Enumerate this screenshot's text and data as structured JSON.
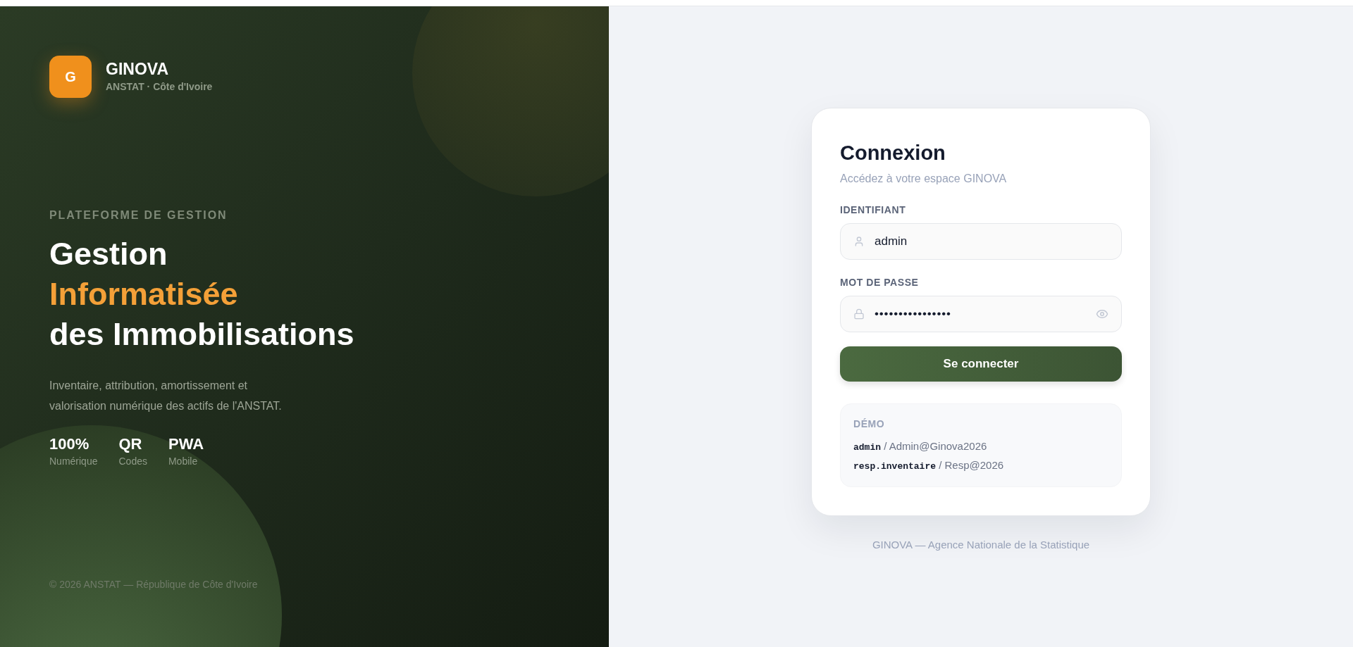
{
  "brand": {
    "logo_letter": "G",
    "name": "GINOVA",
    "subtitle": "ANSTAT · Côte d'Ivoire"
  },
  "hero": {
    "eyebrow": "PLATEFORME DE GESTION",
    "title_lines": [
      {
        "text": "Gestion",
        "accent": false
      },
      {
        "text": "Informatisée",
        "accent": true
      },
      {
        "text": "des Immobilisations",
        "accent": false
      }
    ],
    "description": "Inventaire, attribution, amortissement et valorisation numérique des actifs de l'ANSTAT.",
    "stats": [
      {
        "value": "100%",
        "label": "Numérique"
      },
      {
        "value": "QR",
        "label": "Codes"
      },
      {
        "value": "PWA",
        "label": "Mobile"
      }
    ]
  },
  "left_footer": "© 2026 ANSTAT — République de Côte d'Ivoire",
  "login": {
    "title": "Connexion",
    "subtitle": "Accédez à votre espace GINOVA",
    "fields": [
      {
        "kind": "user",
        "label": "IDENTIFIANT",
        "value": "admin"
      },
      {
        "kind": "password",
        "label": "MOT DE PASSE",
        "value": "••••••••••••••••"
      }
    ],
    "submit": "Se connecter",
    "demo": {
      "title": "DÉMO",
      "lines": [
        "**admin** / Admin@Ginova2026",
        "**resp.inventaire** / Resp@2026"
      ]
    }
  },
  "right_footer": "GINOVA — Agence Nationale de la Statistique"
}
